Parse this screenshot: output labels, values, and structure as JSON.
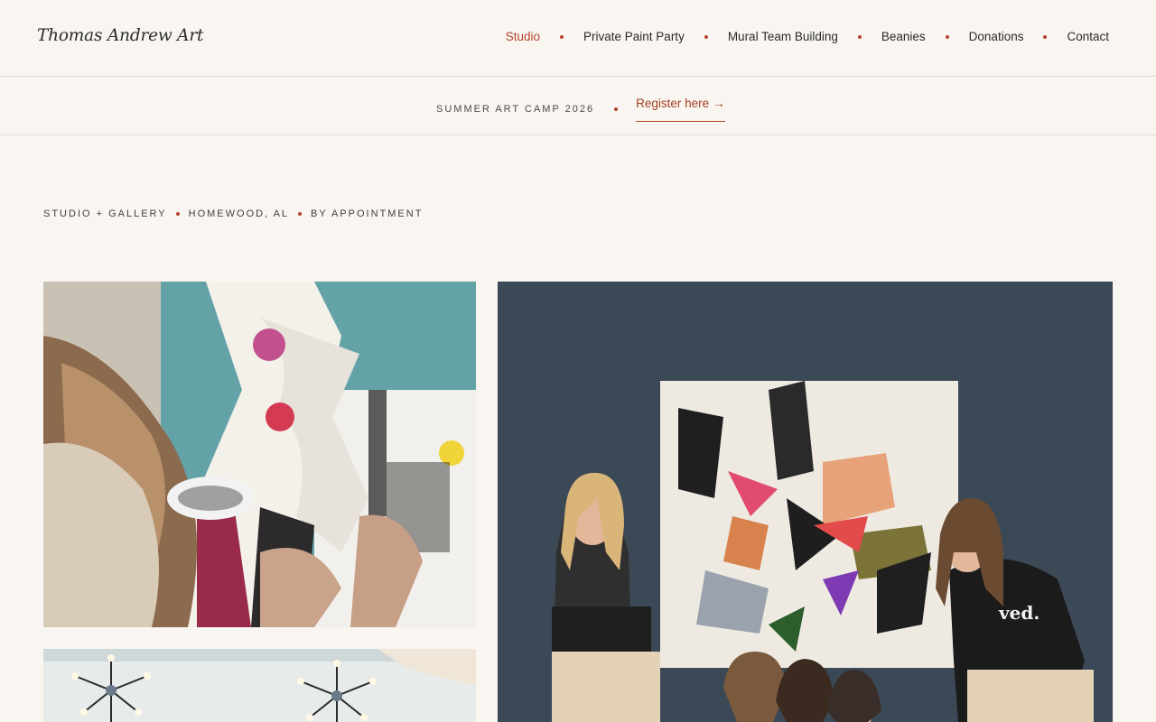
{
  "brand": {
    "name": "Thomas Andrew Art"
  },
  "nav": {
    "items": [
      {
        "label": "Studio",
        "active": true
      },
      {
        "label": "Private Paint Party",
        "active": false
      },
      {
        "label": "Mural Team Building",
        "active": false
      },
      {
        "label": "Beanies",
        "active": false
      },
      {
        "label": "Donations",
        "active": false
      },
      {
        "label": "Contact",
        "active": false
      }
    ]
  },
  "banner": {
    "text": "SUMMER ART CAMP 2026",
    "link_label": "Register here",
    "arrow": "→"
  },
  "meta": {
    "items": [
      "STUDIO + GALLERY",
      "HOMEWOOD, AL",
      "BY APPOINTMENT"
    ]
  },
  "colors": {
    "accent": "#b5442b",
    "background": "#f9f6f1",
    "divider": "#dcd8d1",
    "text": "#2b2b2b"
  }
}
